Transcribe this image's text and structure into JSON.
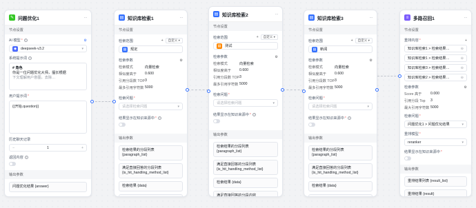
{
  "node1": {
    "title": "问题优化1",
    "section": "节点设置",
    "model_label": "AI 模型",
    "model_value": "deepseek-v3.2",
    "sys_label": "系统提示词",
    "sys_lines": [
      "# 角色",
      "你是一位问题优化大师，擅长根据",
      "下文理解用户意图，去除…"
    ],
    "user_label": "用户提示词",
    "user_value": "{{开始.question}}",
    "history_label": "历史聊天记录",
    "history_value": "1",
    "return_label": "返回内容",
    "out_section": "输出参数",
    "out_item": "问题优化结果 {answer}"
  },
  "kb_nodes": [
    {
      "title": "知识库检索1",
      "dataset": "规定",
      "dataset_color": "#3370ff"
    },
    {
      "title": "知识库检索2",
      "dataset": "测试",
      "dataset_color": "#ff8800"
    },
    {
      "title": "知识库检索3",
      "dataset": "新闻",
      "dataset_color": "#3370ff"
    }
  ],
  "kb_common": {
    "section": "节点设置",
    "range_label": "检索范围",
    "add_label": "+",
    "custom_tag": "自定义",
    "param_label": "检索参数",
    "mode_key": "检索模式",
    "mode_val": "向量检索",
    "sim_key": "相似度高于",
    "sim_val": "0.600",
    "top_key": "引用分段数 TOP",
    "top_val": "3",
    "max_key": "最多引用字符数",
    "max_val": "5000",
    "question_label": "检索问题",
    "question_ph": "请选择检索问题",
    "display_label": "结果显示在知识来源中",
    "out_section": "输出参数",
    "outs": [
      "检索结果的分段列表 {paragraph_list}",
      "满足直接回答的分段列表 {is_hit_handling_method_list}",
      "检索结果 {data}",
      "满足直接回答的分段内容 {directly_return}"
    ]
  },
  "node5": {
    "title": "多路召回1",
    "section": "节点设置",
    "content_label": "重排内容",
    "items": [
      "知识库检索1 > 检索结果…",
      "知识库检索1 > 检索结果…",
      "知识库检索3 > 检索结果…",
      "知识库检索2 > 检索结果…"
    ],
    "param_label": "检索参数",
    "score_key": "Score 高于",
    "score_val": "0.000",
    "top_key": "引用分段 Top",
    "top_val": "3",
    "max_key": "最大引用字符数",
    "max_val": "5000",
    "question_label": "检索问题",
    "question_value": "问题优化1 > 问题优化结果",
    "model_label": "重排模型",
    "model_value": "reranker",
    "display_label": "结果显示在知识来源中",
    "out_section": "输出参数",
    "outs": [
      "重排结果列表 {result_list}",
      "重排结果 {result}"
    ]
  }
}
